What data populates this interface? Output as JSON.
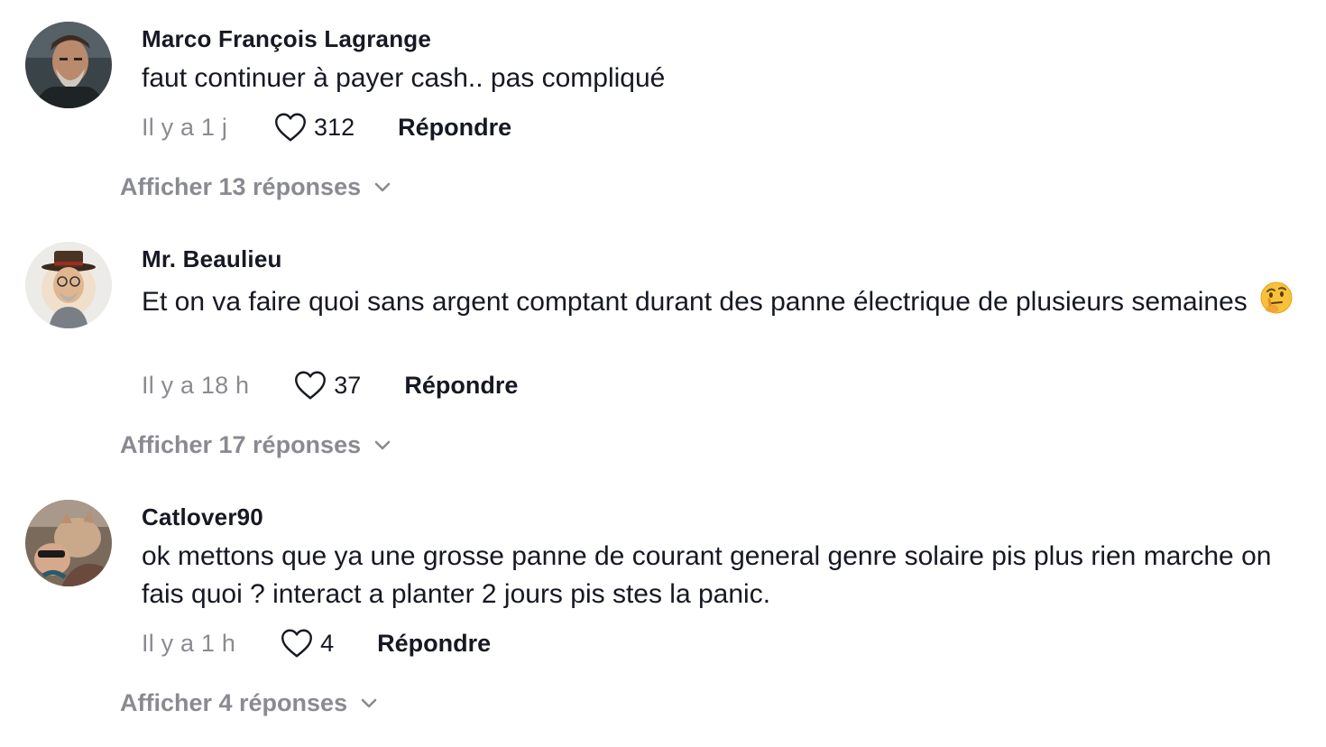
{
  "comments": [
    {
      "username": "Marco François Lagrange",
      "text": "faut continuer à payer cash.. pas compliqué",
      "time": "Il y a 1 j",
      "likes": "312",
      "reply_label": "Répondre",
      "view_replies": "Afficher 13 réponses",
      "avatar": "avatar-bearded-man"
    },
    {
      "username": "Mr. Beaulieu",
      "text": "Et on va faire quoi sans argent comptant durant des panne électrique de plusieurs semaines",
      "emoji": "thinking-face-emoji",
      "time": "Il y a 18 h",
      "likes": "37",
      "reply_label": "Répondre",
      "view_replies": "Afficher 17 réponses",
      "avatar": "avatar-man-with-hat-cartoon"
    },
    {
      "username": "Catlover90",
      "text": "ok mettons que ya une grosse panne de courant general genre solaire pis plus rien marche on fais quoi ? interact a planter 2 jours pis stes la panic.",
      "time": "Il y a 1 h",
      "likes": "4",
      "reply_label": "Répondre",
      "view_replies": "Afficher 4 réponses",
      "avatar": "avatar-person-with-cat"
    }
  ],
  "colors": {
    "text_primary": "#161823",
    "text_secondary": "#8a8b91",
    "background": "#ffffff"
  }
}
